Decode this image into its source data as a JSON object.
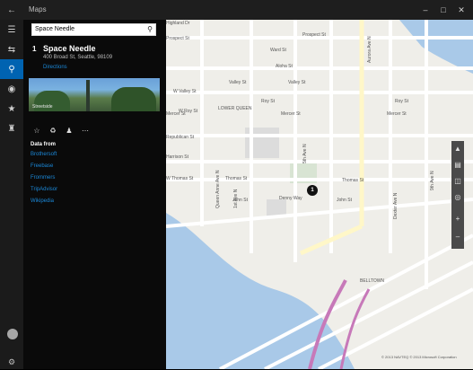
{
  "window": {
    "title": "Maps",
    "back_icon": "back-arrow-icon"
  },
  "rail": {
    "items": [
      "hamburger-icon",
      "directions-icon",
      "search-icon",
      "location-icon",
      "favorites-icon",
      "collections-icon"
    ],
    "settings_icon": "gear-icon"
  },
  "search": {
    "value": "Space Needle"
  },
  "result": {
    "index": "1",
    "name": "Space Needle",
    "address": "400 Broad St, Seattle, 98109",
    "directions": "Directions",
    "photo_caption": "Streetside"
  },
  "data_from": {
    "heading": "Data from",
    "sources": [
      "Brothersoft",
      "Freebase",
      "Frommers",
      "TripAdvisor",
      "Wikipedia"
    ]
  },
  "map": {
    "pin": "1",
    "streets": {
      "highland": "Highland Dr",
      "prospect_left": "Prospect St",
      "prospect": "Prospect St",
      "ward": "Ward St",
      "aloha": "Aloha St",
      "valley_left": "W Valley St",
      "valley": "Valley St",
      "roy_left": "W Roy St",
      "roy": "Roy St",
      "lower_queen": "LOWER QUEEN",
      "mercer_left": "Mercer St",
      "mercer": "Mercer St",
      "mercer_right": "Mercer St",
      "republican": "Republican St",
      "harrison": "Harrison St",
      "thomas_w": "W Thomas St",
      "thomas": "Thomas St",
      "thomas_right": "Thomas St",
      "john": "John St",
      "denny": "Denny Way",
      "belltown": "BELLTOWN",
      "queen_anne": "Queen Anne Ave N",
      "first_ave": "1st Ave N",
      "fifth_ave": "5th Ave N",
      "aurora": "Aurora Ave N",
      "dexter": "Dexter Ave N",
      "ninth": "9th Ave N"
    },
    "attribution": "© 2013 NAVTEQ © 2013 Microsoft Corporation"
  },
  "colors": {
    "accent": "#0063b1",
    "link": "#1b88d8",
    "water": "#a9c9e8",
    "map_bg": "#efeee9"
  }
}
